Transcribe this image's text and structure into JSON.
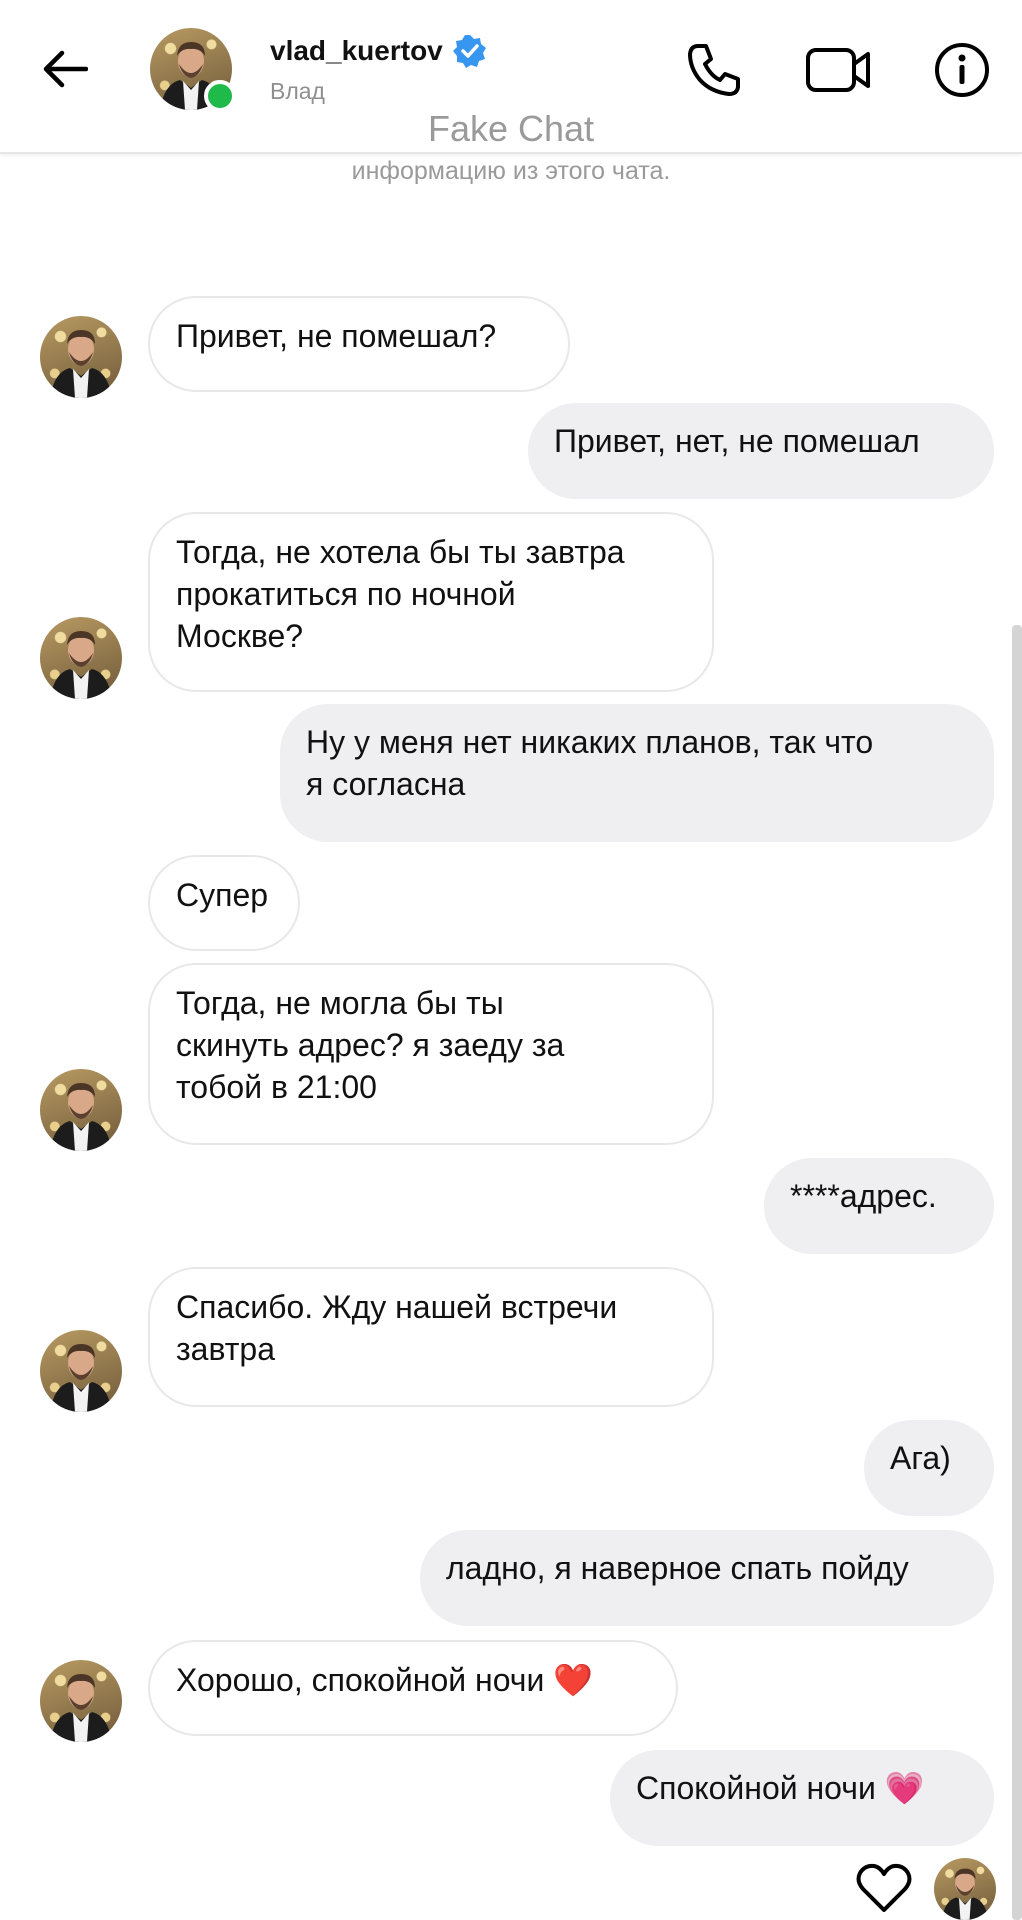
{
  "header": {
    "username": "vlad_kuertov",
    "display_name": "Влад",
    "watermark": "Fake Chat",
    "icons": [
      "back-arrow-icon",
      "verified-badge-icon",
      "phone-icon",
      "video-camera-icon",
      "info-icon"
    ]
  },
  "notice_partial": "информацию из этого чата.",
  "messages": [
    {
      "side": "in",
      "text": "Привет, не помешал?"
    },
    {
      "side": "out",
      "text": "Привет, нет, не помешал"
    },
    {
      "side": "in",
      "text": "Тогда, не хотела бы ты завтра\nпрокатиться по ночной\nМоскве?"
    },
    {
      "side": "out",
      "text": "Ну у меня нет никаких планов, так что\nя согласна"
    },
    {
      "side": "in",
      "text": "Супер"
    },
    {
      "side": "in",
      "text": "Тогда, не могла бы ты\nскинуть адрес? я заеду за\nтобой в 21:00"
    },
    {
      "side": "out",
      "text": "****адрес."
    },
    {
      "side": "in",
      "text": "Спасибо. Жду нашей встречи\nзавтра"
    },
    {
      "side": "out",
      "text": "Ага)"
    },
    {
      "side": "out",
      "text": "ладно, я наверное спать пойду"
    },
    {
      "side": "in",
      "text": "Хорошо, спокойной ночи ❤️"
    },
    {
      "side": "out",
      "text": "Спокойной ночи 💗"
    }
  ],
  "colors": {
    "online": "#1fba4a",
    "verified": "#3797f0",
    "outgoing_bubble": "#efeff2",
    "incoming_border": "#e8e8e8"
  }
}
